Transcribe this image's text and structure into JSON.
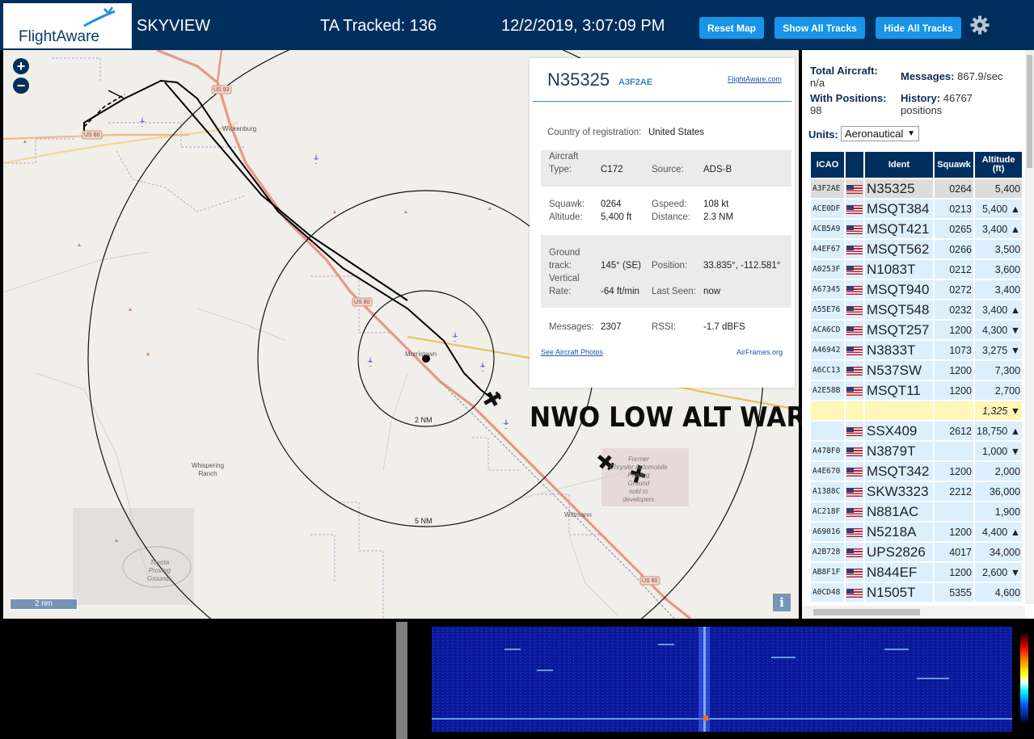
{
  "header": {
    "logo_text": "FlightAware",
    "app_title": "SKYVIEW",
    "tracked": "TA Tracked: 136",
    "datetime": "12/2/2019, 3:07:09 PM",
    "buttons": {
      "reset_map": "Reset Map",
      "show_all": "Show All Tracks",
      "hide_all": "Hide All Tracks"
    }
  },
  "map": {
    "zoom_in": "+",
    "zoom_out": "−",
    "scale": "2 nm",
    "info": "i",
    "ring_labels": [
      "2 NM",
      "5 NM"
    ],
    "places": {
      "wickenburg": "Wickenburg",
      "morristown": "Morristown",
      "whispering": "Whispering\nRanch",
      "wittmann": "Wittmann",
      "toyota": "Toyota\nProving\nGrounds",
      "chrysler": "Former\nChrysler Automobile\nProving\nGround\nsold to\ndevelopers"
    },
    "road_shields": {
      "us93": "US 93",
      "us60a": "US 60",
      "us60b": "US 60",
      "us60c": "US 60"
    },
    "overlay_text": "NWO LOW ALT WARRIOR"
  },
  "infopanel": {
    "ident": "N35325",
    "icao": "A3F2AE",
    "fa_link": "FlightAware.com",
    "country_label": "Country of registration:",
    "country_value": "United States",
    "aircraft_type_label": "Aircraft\nType:",
    "aircraft_type": "C172",
    "source_label": "Source:",
    "source": "ADS-B",
    "squawk_label": "Squawk:",
    "squawk": "0264",
    "gspeed_label": "Gspeed:",
    "gspeed": "108 kt",
    "altitude_label": "Altitude:",
    "altitude": "5,400 ft",
    "distance_label": "Distance:",
    "distance": "2.3 NM",
    "ground_track_label": "Ground\ntrack:",
    "ground_track": "145° (SE)",
    "position_label": "Position:",
    "position": "33.835°, -112.581°",
    "vrate_label": "Vertical\nRate:",
    "vrate": "-64 ft/min",
    "lastseen_label": "Last Seen:",
    "lastseen": "now",
    "messages_label": "Messages:",
    "messages": "2307",
    "rssi_label": "RSSI:",
    "rssi": "-1.7 dBFS",
    "photos_link": "See Aircraft Photos",
    "airframes_link": "AirFrames.org"
  },
  "side": {
    "total_label": "Total Aircraft:",
    "total_value": "n/a",
    "messages_label": "Messages:",
    "messages_value": "867.9/sec",
    "positions_label": "With Positions:",
    "positions_value": "98",
    "history_label": "History:",
    "history_value": "46767\npositions",
    "units_label": "Units:",
    "units_value": "Aeronautical",
    "columns": [
      "ICAO",
      "",
      "Ident",
      "Squawk",
      "Altitude\n(ft)"
    ],
    "rows": [
      {
        "icao": "A3F2AE",
        "ident": "N35325",
        "squawk": "0264",
        "alt": "5,400",
        "sel": true
      },
      {
        "icao": "ACE0DF",
        "ident": "MSQT384",
        "squawk": "0213",
        "alt": "5,400 ▲"
      },
      {
        "icao": "ACB5A9",
        "ident": "MSQT421",
        "squawk": "0265",
        "alt": "3,400 ▲"
      },
      {
        "icao": "A4EF67",
        "ident": "MSQT562",
        "squawk": "0266",
        "alt": "3,500"
      },
      {
        "icao": "A0253F",
        "ident": "N1083T",
        "squawk": "0212",
        "alt": "3,600"
      },
      {
        "icao": "A67345",
        "ident": "MSQT940",
        "squawk": "0272",
        "alt": "3,400"
      },
      {
        "icao": "A55E76",
        "ident": "MSQT548",
        "squawk": "0232",
        "alt": "3,400 ▲"
      },
      {
        "icao": "ACA6CD",
        "ident": "MSQT257",
        "squawk": "1200",
        "alt": "4,300 ▼"
      },
      {
        "icao": "A46942",
        "ident": "N3833T",
        "squawk": "1073",
        "alt": "3,275 ▼"
      },
      {
        "icao": "A6CC13",
        "ident": "N537SW",
        "squawk": "1200",
        "alt": "7,300"
      },
      {
        "icao": "A2E58B",
        "ident": "MSQT11",
        "squawk": "1200",
        "alt": "2,700"
      },
      {
        "icao": "",
        "ident": "",
        "squawk": "",
        "alt": "1,325 ▼",
        "hl": true,
        "noflag": true
      },
      {
        "icao": "",
        "ident": "SSX409",
        "squawk": "2612",
        "alt": "18,750 ▲"
      },
      {
        "icao": "A478F0",
        "ident": "N3879T",
        "squawk": "",
        "alt": "1,000 ▼"
      },
      {
        "icao": "A4E670",
        "ident": "MSQT342",
        "squawk": "1200",
        "alt": "2,000"
      },
      {
        "icao": "A1388C",
        "ident": "SKW3323",
        "squawk": "2212",
        "alt": "36,000"
      },
      {
        "icao": "AC218F",
        "ident": "N881AC",
        "squawk": "",
        "alt": "1,900"
      },
      {
        "icao": "A69016",
        "ident": "N5218A",
        "squawk": "1200",
        "alt": "4,400 ▲"
      },
      {
        "icao": "A2B728",
        "ident": "UPS2826",
        "squawk": "4017",
        "alt": "34,000"
      },
      {
        "icao": "AB8F1F",
        "ident": "N844EF",
        "squawk": "1200",
        "alt": "2,600 ▼"
      },
      {
        "icao": "A0CD48",
        "ident": "N1505T",
        "squawk": "5355",
        "alt": "4,600"
      }
    ]
  },
  "colors": {
    "header": "#002f5d",
    "button": "#1894e8",
    "row": "#dcefff",
    "selected_row": "#dcdcdc",
    "highlight_row": "#fff6b8",
    "track": "#000000",
    "road": "#e8968a"
  }
}
